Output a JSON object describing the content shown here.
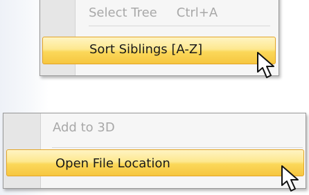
{
  "menu_top": {
    "disabled_item": {
      "label": "Select Tree",
      "shortcut": "Ctrl+A"
    },
    "highlighted_item": {
      "label": "Sort Siblings [A-Z]"
    }
  },
  "menu_bottom": {
    "disabled_item": {
      "label": "Add to 3D"
    },
    "highlighted_item": {
      "label": "Open File Location"
    }
  },
  "icons": {
    "cursor": "mouse-pointer-icon"
  },
  "colors": {
    "highlight_fill": "#fbd85a",
    "highlight_border": "#e2a428",
    "disabled_text": "#a8a8a8",
    "menu_background": "#f6f6f6"
  }
}
